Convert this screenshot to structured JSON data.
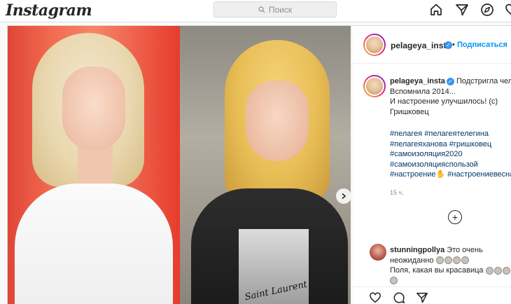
{
  "topbar": {
    "logo": "Instagram",
    "search_placeholder": "Поиск"
  },
  "post": {
    "author": "pelageya_insta",
    "follow_label": "Подписаться",
    "dot": "•",
    "caption_lines": [
      "Подстригла челку",
      "Вспомнила 2014...",
      "И настроение улучшилось! (с)",
      "Гришковец"
    ],
    "hashtags": [
      "#пелагея #пелагеятелегина",
      "#пелагеяханова #гришковец",
      "#самоизоляция2020",
      "#самоизоляцияспользой",
      "#настроение✋ #настроениевесна"
    ],
    "time": "15 ч."
  },
  "comment": {
    "author": "stunningpollya",
    "line1": "Это очень",
    "line2": "неожиданно",
    "line3": "Поля, какая вы красавица"
  },
  "photo": {
    "signature": "Saint Laurent"
  },
  "colors": {
    "link": "#0095f6",
    "hashtag": "#00376b",
    "verified": "#3897f0"
  }
}
